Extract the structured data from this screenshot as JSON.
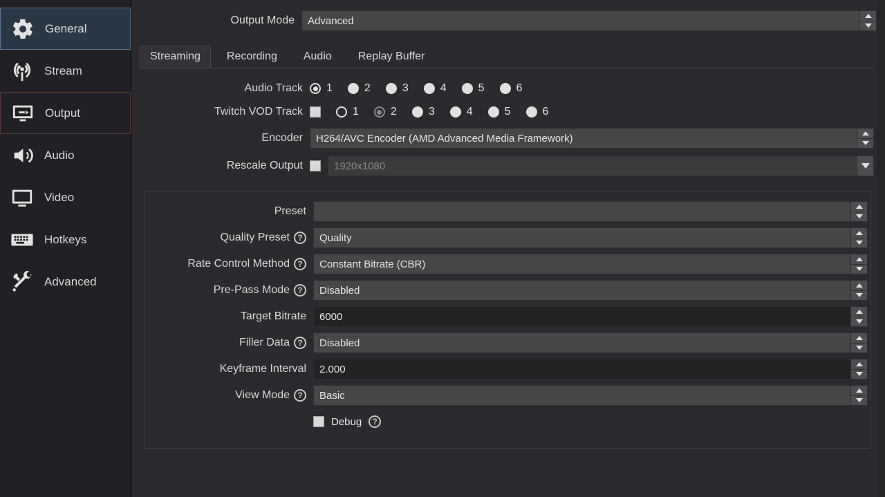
{
  "sidebar": {
    "items": [
      {
        "id": "general",
        "label": "General"
      },
      {
        "id": "stream",
        "label": "Stream"
      },
      {
        "id": "output",
        "label": "Output"
      },
      {
        "id": "audio",
        "label": "Audio"
      },
      {
        "id": "video",
        "label": "Video"
      },
      {
        "id": "hotkeys",
        "label": "Hotkeys"
      },
      {
        "id": "advanced",
        "label": "Advanced"
      }
    ]
  },
  "output_mode": {
    "label": "Output Mode",
    "value": "Advanced"
  },
  "tabs": [
    {
      "id": "streaming",
      "label": "Streaming"
    },
    {
      "id": "recording",
      "label": "Recording"
    },
    {
      "id": "audio",
      "label": "Audio"
    },
    {
      "id": "replay-buffer",
      "label": "Replay Buffer"
    }
  ],
  "active_tab": "streaming",
  "audio_track": {
    "label": "Audio Track",
    "options": [
      "1",
      "2",
      "3",
      "4",
      "5",
      "6"
    ],
    "selected": "1"
  },
  "twitch_vod_track": {
    "label": "Twitch VOD Track",
    "enabled": false,
    "options": [
      "1",
      "2",
      "3",
      "4",
      "5",
      "6"
    ],
    "selected": "2"
  },
  "encoder": {
    "label": "Encoder",
    "value": "H264/AVC Encoder (AMD Advanced Media Framework)"
  },
  "rescale_output": {
    "label": "Rescale Output",
    "enabled": false,
    "placeholder": "1920x1080"
  },
  "encoder_settings": {
    "preset": {
      "label": "Preset",
      "value": ""
    },
    "quality_preset": {
      "label": "Quality Preset",
      "value": "Quality"
    },
    "rate_control_method": {
      "label": "Rate Control Method",
      "value": "Constant Bitrate (CBR)"
    },
    "pre_pass_mode": {
      "label": "Pre-Pass Mode",
      "value": "Disabled"
    },
    "target_bitrate": {
      "label": "Target Bitrate",
      "value": "6000"
    },
    "filler_data": {
      "label": "Filler Data",
      "value": "Disabled"
    },
    "keyframe_interval": {
      "label": "Keyframe Interval",
      "value": "2.000"
    },
    "view_mode": {
      "label": "View Mode",
      "value": "Basic"
    },
    "debug": {
      "label": "Debug",
      "checked": false
    }
  }
}
